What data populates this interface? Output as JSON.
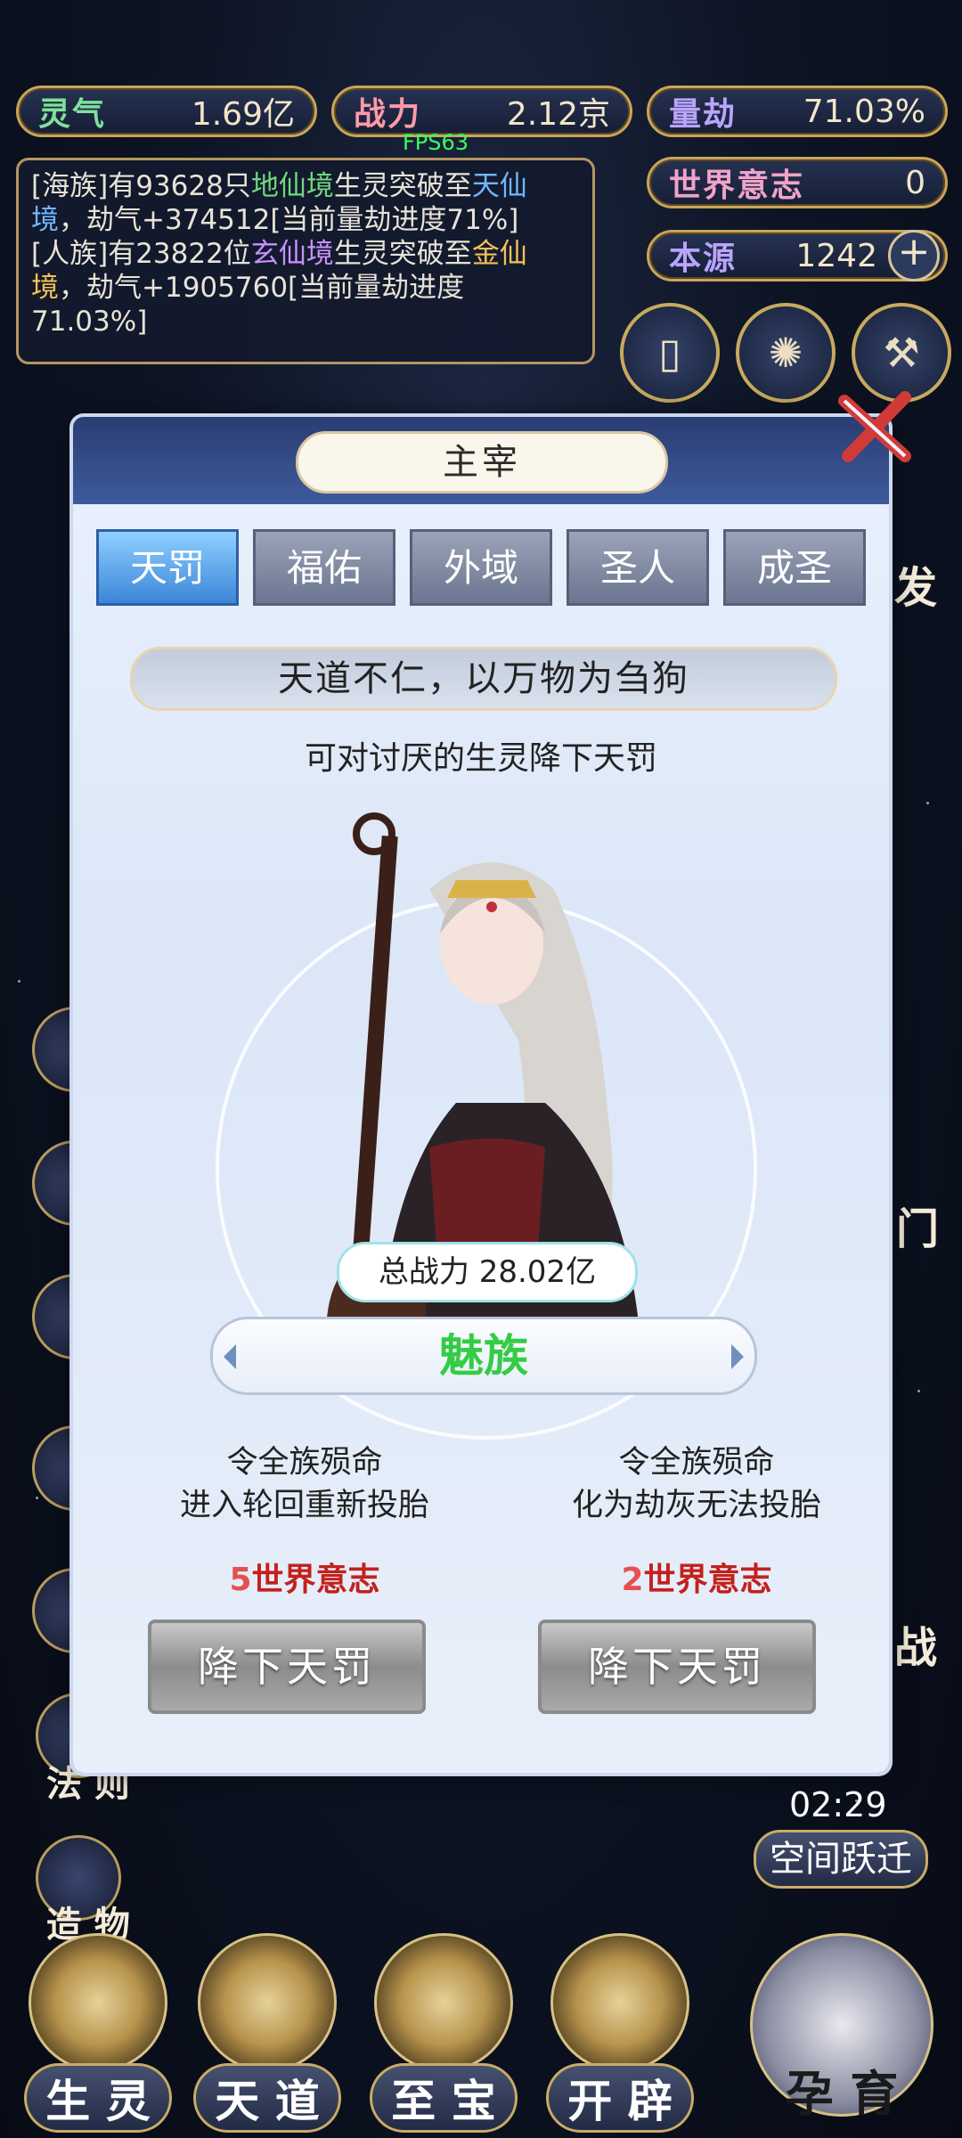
{
  "stats": {
    "lingqi_label": "灵气",
    "lingqi_value": "1.69亿",
    "zhanli_label": "战力",
    "zhanli_value": "2.12京",
    "liangjie_label": "量劫",
    "liangjie_value": "71.03%",
    "shijie_label": "世界意志",
    "shijie_value": "0",
    "benyuan_label": "本源",
    "benyuan_value": "1242",
    "fps": "FPS63"
  },
  "log": {
    "line1_a": "[海族]有93628只",
    "line1_b": "地仙境",
    "line1_c": "生灵突破至",
    "line1_d": "天仙境",
    "line1_e": "，劫气+374512[当前量劫进度71%]",
    "line2_a": "[人族]有23822位",
    "line2_b": "玄仙境",
    "line2_c": "生灵突破至",
    "line2_d": "金仙境",
    "line2_e": "，劫气+1905760[当前量劫进度71.03%]"
  },
  "side": {
    "left_fa": "法 则",
    "left_zao": "造 物",
    "right_fa": "发",
    "right_men": "门",
    "right_zhan": "战",
    "timer": "02:29",
    "space_jump": "空间跃迁"
  },
  "nav": {
    "shengling": "生 灵",
    "tiandao": "天 道",
    "zhibao": "至 宝",
    "kaipi": "开 辟",
    "yunyu": "孕 育"
  },
  "modal": {
    "title": "主宰",
    "tabs": [
      "天罚",
      "福佑",
      "外域",
      "圣人",
      "成圣"
    ],
    "motto": "天道不仁，以万物为刍狗",
    "desc": "可对讨厌的生灵降下天罚",
    "power": "总战力 28.02亿",
    "race": "魅族",
    "option1": {
      "line1": "令全族殒命",
      "line2": "进入轮回重新投胎",
      "cost_num": "5",
      "cost_label": "世界意志",
      "button": "降下天罚"
    },
    "option2": {
      "line1": "令全族殒命",
      "line2": "化为劫灰无法投胎",
      "cost_num": "2",
      "cost_label": "世界意志",
      "button": "降下天罚"
    }
  }
}
